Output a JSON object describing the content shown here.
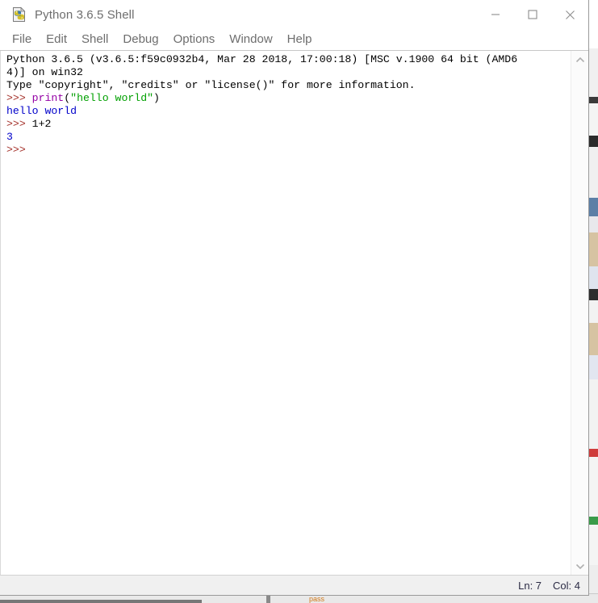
{
  "window": {
    "title": "Python 3.6.5 Shell",
    "icon": "python-file-icon",
    "controls": {
      "minimize": "minimize-icon",
      "maximize": "maximize-icon",
      "close": "close-icon"
    }
  },
  "menubar": {
    "items": [
      {
        "label": "File"
      },
      {
        "label": "Edit"
      },
      {
        "label": "Shell"
      },
      {
        "label": "Debug"
      },
      {
        "label": "Options"
      },
      {
        "label": "Window"
      },
      {
        "label": "Help"
      }
    ]
  },
  "shell": {
    "lines": [
      [
        {
          "text": "Python 3.6.5 (v3.6.5:f59c0932b4, Mar 28 2018, 17:00:18) [MSC v.1900 64 bit (AMD6",
          "style": "black"
        }
      ],
      [
        {
          "text": "4)] on win32",
          "style": "black"
        }
      ],
      [
        {
          "text": "Type \"copyright\", \"credits\" or \"license()\" for more information.",
          "style": "black"
        }
      ],
      [
        {
          "text": ">>> ",
          "style": "prompt"
        },
        {
          "text": "print",
          "style": "builtin"
        },
        {
          "text": "(",
          "style": "black"
        },
        {
          "text": "\"hello world\"",
          "style": "string"
        },
        {
          "text": ")",
          "style": "black"
        }
      ],
      [
        {
          "text": "hello world",
          "style": "output"
        }
      ],
      [
        {
          "text": ">>> ",
          "style": "prompt"
        },
        {
          "text": "1+2",
          "style": "black"
        }
      ],
      [
        {
          "text": "3",
          "style": "output"
        }
      ],
      [
        {
          "text": ">>>",
          "style": "prompt"
        }
      ]
    ],
    "colors": {
      "prompt": "#a5322b",
      "builtin": "#9400a5",
      "string": "#00a000",
      "output": "#0000ca",
      "plain": "#000000"
    }
  },
  "scrollbar": {
    "up": "chevron-up-icon",
    "down": "chevron-down-icon"
  },
  "statusbar": {
    "line_label": "Ln: 7",
    "col_label": "Col: 4"
  },
  "background": {
    "bottom_text": "pass"
  }
}
